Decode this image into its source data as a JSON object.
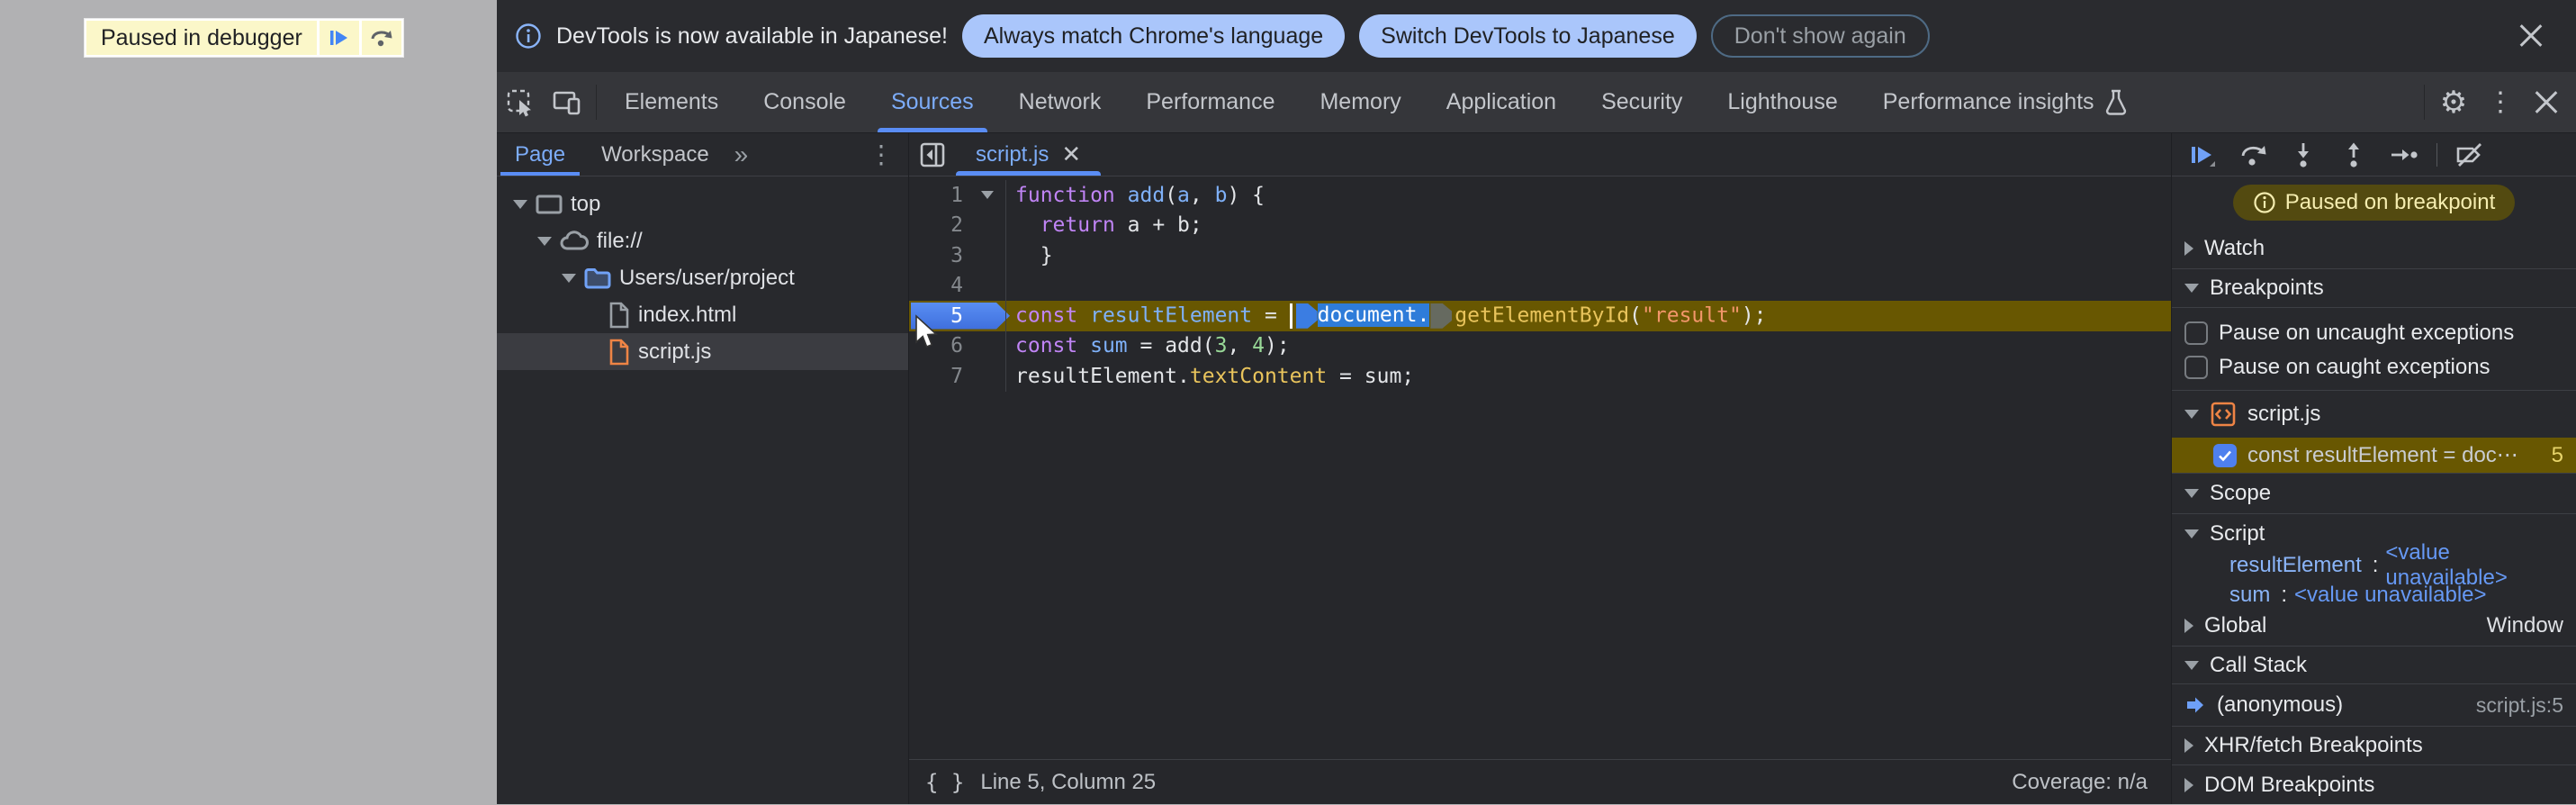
{
  "page_overlay": {
    "label": "Paused in debugger"
  },
  "banner": {
    "message": "DevTools is now available in Japanese!",
    "actions": [
      "Always match Chrome's language",
      "Switch DevTools to Japanese"
    ],
    "dismiss": "Don't show again"
  },
  "main_tabs": {
    "items": [
      "Elements",
      "Console",
      "Sources",
      "Network",
      "Performance",
      "Memory",
      "Application",
      "Security",
      "Lighthouse",
      "Performance insights"
    ],
    "active_index": 2
  },
  "icons": {
    "gear": "⚙",
    "kebab": "⋮",
    "more_tabs": "»",
    "tab_close": "✕"
  },
  "navigator": {
    "tabs": [
      "Page",
      "Workspace"
    ],
    "active_index": 0,
    "tree": [
      {
        "label": "top",
        "depth": 0,
        "expanded": true,
        "icon": "frame"
      },
      {
        "label": "file://",
        "depth": 1,
        "expanded": true,
        "icon": "cloud"
      },
      {
        "label": "Users/user/project",
        "depth": 2,
        "expanded": true,
        "icon": "folder"
      },
      {
        "label": "index.html",
        "depth": 3,
        "icon": "file",
        "color": "#9aa0a6"
      },
      {
        "label": "script.js",
        "depth": 3,
        "icon": "file",
        "color": "#ee8445",
        "selected": true
      }
    ]
  },
  "editor": {
    "tab_label": "script.js",
    "lines": [
      {
        "n": 1,
        "fold": true,
        "tokens": [
          [
            "kw",
            "function"
          ],
          [
            "pl",
            " "
          ],
          [
            "def",
            "add"
          ],
          [
            "pl",
            "("
          ],
          [
            "def",
            "a"
          ],
          [
            "pl",
            ", "
          ],
          [
            "def",
            "b"
          ],
          [
            "pl",
            ") {"
          ]
        ]
      },
      {
        "n": 2,
        "tokens": [
          [
            "pl",
            "  "
          ],
          [
            "kw",
            "return"
          ],
          [
            "pl",
            " a + b;"
          ]
        ]
      },
      {
        "n": 3,
        "tokens": [
          [
            "pl",
            "  }"
          ]
        ]
      },
      {
        "n": 4,
        "tokens": []
      },
      {
        "n": 5,
        "current": true,
        "tokens": [
          [
            "kw",
            "const"
          ],
          [
            "pl",
            " "
          ],
          [
            "def",
            "resultElement"
          ],
          [
            "pl",
            " = "
          ],
          [
            "caret",
            ""
          ],
          [
            "marker-active",
            ""
          ],
          [
            "sel",
            "document."
          ],
          [
            "marker",
            ""
          ],
          [
            "prop",
            "getElementById"
          ],
          [
            "pl",
            "("
          ],
          [
            "str",
            "\"result\""
          ],
          [
            "pl",
            ");"
          ]
        ]
      },
      {
        "n": 6,
        "tokens": [
          [
            "kw",
            "const"
          ],
          [
            "pl",
            " "
          ],
          [
            "def",
            "sum"
          ],
          [
            "pl",
            " = add("
          ],
          [
            "num",
            "3"
          ],
          [
            "pl",
            ", "
          ],
          [
            "num",
            "4"
          ],
          [
            "pl",
            ");"
          ]
        ]
      },
      {
        "n": 7,
        "tokens": [
          [
            "pl",
            "resultElement."
          ],
          [
            "prop",
            "textContent"
          ],
          [
            "pl",
            " = sum;"
          ]
        ]
      }
    ],
    "status": {
      "position": "Line 5, Column 25",
      "coverage": "Coverage: n/a"
    }
  },
  "debugger": {
    "paused_badge": "Paused on breakpoint",
    "watch_title": "Watch",
    "breakpoints": {
      "title": "Breakpoints",
      "checkboxes": [
        {
          "label": "Pause on uncaught exceptions",
          "checked": false
        },
        {
          "label": "Pause on caught exceptions",
          "checked": false
        }
      ],
      "file_group": "script.js",
      "entry": {
        "checked": true,
        "text": "const resultElement = doc⋯",
        "line": "5"
      }
    },
    "scope": {
      "title": "Scope",
      "script_group": "Script",
      "variables": [
        {
          "name": "resultElement",
          "value": "<value unavailable>"
        },
        {
          "name": "sum",
          "value": "<value unavailable>"
        }
      ],
      "global_label": "Global",
      "global_value": "Window"
    },
    "call_stack": {
      "title": "Call Stack",
      "frames": [
        {
          "name": "(anonymous)",
          "location": "script.js:5"
        }
      ]
    },
    "xhr_title": "XHR/fetch Breakpoints",
    "dom_title": "DOM Breakpoints"
  },
  "punct": {
    "colon": ":"
  }
}
